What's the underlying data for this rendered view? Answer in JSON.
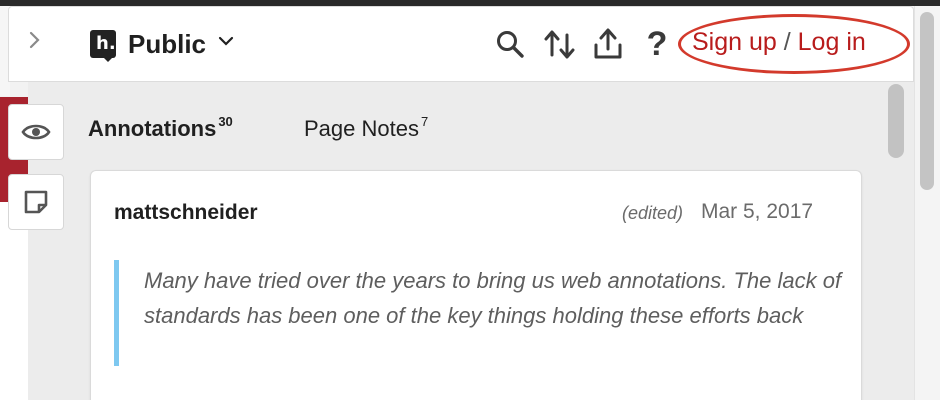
{
  "header": {
    "group_name": "Public",
    "login_text": "Sign up / Log in",
    "login_parts": {
      "signup": "Sign up",
      "separator": "/",
      "login": "Log in"
    },
    "icons": [
      "chevron-right-icon",
      "hypothesis-logo-icon",
      "search-icon",
      "sort-icon",
      "share-icon",
      "help-icon"
    ]
  },
  "tabs": [
    {
      "label": "Annotations",
      "count": "30",
      "selected": true
    },
    {
      "label": "Page Notes",
      "count": "7",
      "selected": false
    }
  ],
  "annotation": {
    "user": "mattschneider",
    "edited_label": "(edited)",
    "date": "Mar 5, 2017",
    "quote": "Many have tried over the years to bring us web annotations. The lack of standards has been one of the key things holding these efforts back"
  },
  "colors": {
    "accent_red": "#b81c1c",
    "highlight_ring": "#d33a2c",
    "quote_bar": "#7ec8f0"
  }
}
